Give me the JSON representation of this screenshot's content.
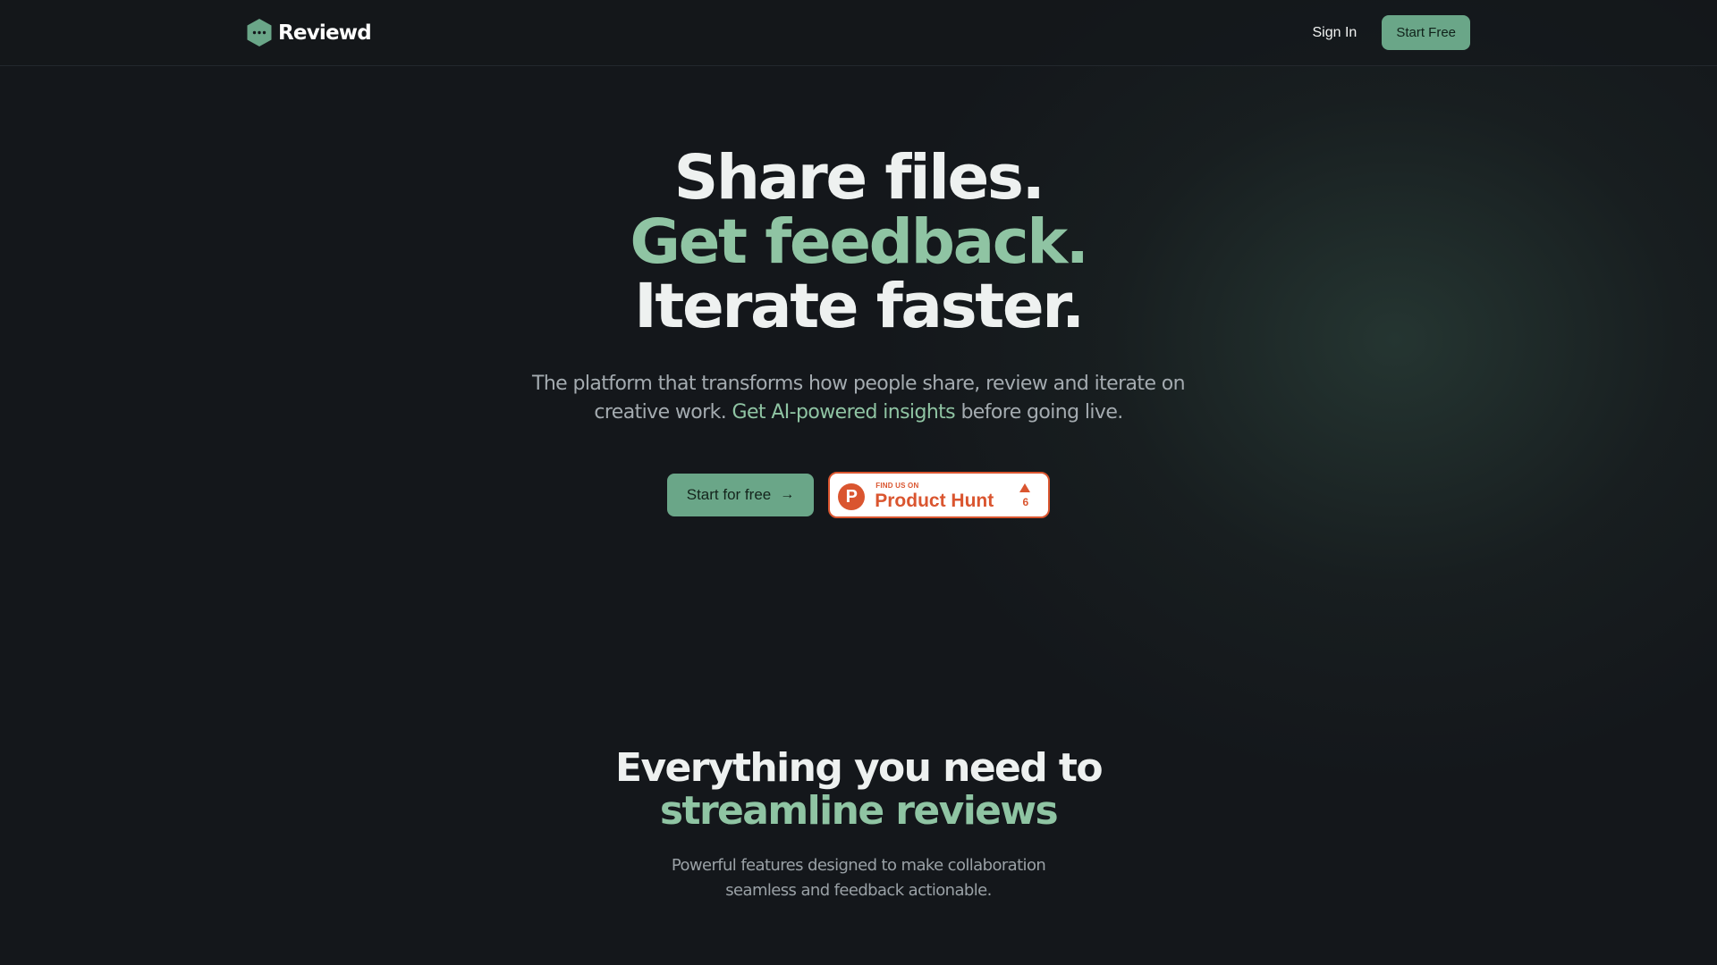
{
  "header": {
    "brand": "Reviewd",
    "signin_label": "Sign In",
    "start_free_label": "Start Free"
  },
  "hero": {
    "line1": "Share files.",
    "line2": "Get feedback.",
    "line3": "Iterate faster.",
    "subtitle_pre": "The platform that transforms how people share, review and iterate on creative work. ",
    "subtitle_highlight": "Get AI-powered insights",
    "subtitle_post": " before going live.",
    "cta_label": "Start for free",
    "cta_icon": "arrow-right-icon"
  },
  "product_hunt": {
    "small_text": "FIND US ON",
    "big_text": "Product Hunt",
    "logo_letter": "P",
    "upvotes": "6",
    "brand_color": "#da552f"
  },
  "features": {
    "title_line1": "Everything you need to",
    "title_line2": "streamline reviews",
    "subtitle": "Powerful features designed to make collaboration seamless and feedback actionable."
  },
  "colors": {
    "background": "#14171b",
    "accent": "#6aa688",
    "accent_text": "#8fc4a3"
  }
}
